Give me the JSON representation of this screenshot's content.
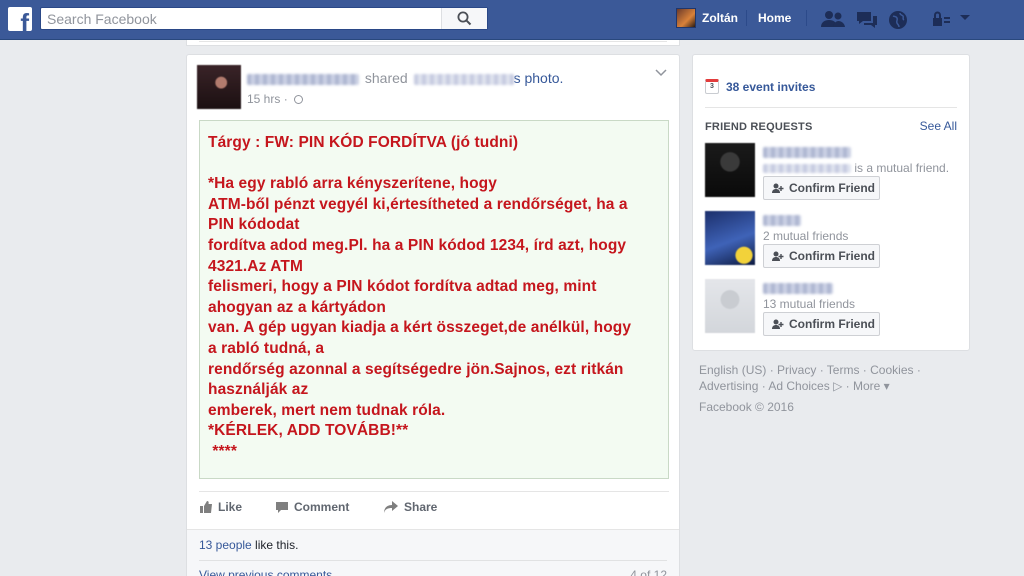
{
  "topbar": {
    "search_placeholder": "Search Facebook",
    "user_name": "Zoltán",
    "home_label": "Home"
  },
  "post": {
    "action_text": "shared",
    "object_text": "photo.",
    "time": "15 hrs",
    "message": "Tárgy : FW: PIN KÓD FORDÍTVA (jó tudni)\n\n*Ha egy rabló arra kényszerítene, hogy\nATM-ből pénzt vegyél ki,értesítheted a rendőrséget, ha a\nPIN kódodat\nfordítva adod meg.Pl. ha a PIN kódod 1234, írd azt, hogy\n4321.Az ATM\nfelismeri, hogy a PIN kódot fordítva adtad meg, mint\nahogyan az a kártyádon\nvan. A gép ugyan kiadja a kért összeget,de anélkül, hogy\na rabló tudná, a\nrendőrség azonnal a segítségedre jön.Sajnos, ezt ritkán\nhasználják az\nemberek, mert nem tudnak róla.\n*KÉRLEK, ADD TOVÁBB!**\n ****",
    "actions": {
      "like": "Like",
      "comment": "Comment",
      "share": "Share"
    },
    "likes_count": "13 people",
    "likes_suffix": " like this.",
    "view_previous": "View previous comments",
    "comment_count": "4 of 12"
  },
  "sidebar": {
    "event_invites": "38 event invites",
    "calendar_day": "3",
    "friend_requests_title": "FRIEND REQUESTS",
    "see_all": "See All",
    "requests": [
      {
        "mutual": "is a mutual friend.",
        "button": "Confirm Friend"
      },
      {
        "mutual": "2 mutual friends",
        "button": "Confirm Friend"
      },
      {
        "mutual": "13 mutual friends",
        "button": "Confirm Friend"
      }
    ]
  },
  "footer": {
    "line1": "English (US) · Privacy · Terms · Cookies ·",
    "line2": "Advertising · Ad Choices ▷ · More ▾",
    "copyright": "Facebook © 2016"
  },
  "colors": {
    "brand": "#3b5998",
    "link": "#365899",
    "message_text": "#c5161d",
    "message_bg": "#f3fbf2"
  },
  "icons": [
    "facebook-logo-icon",
    "search-icon",
    "friends-icon",
    "messages-icon",
    "notifications-globe-icon",
    "privacy-lock-icon",
    "account-chevron-icon",
    "globe-icon",
    "chevron-down-icon",
    "like-icon",
    "comment-icon",
    "share-icon",
    "calendar-icon",
    "add-friend-icon"
  ]
}
